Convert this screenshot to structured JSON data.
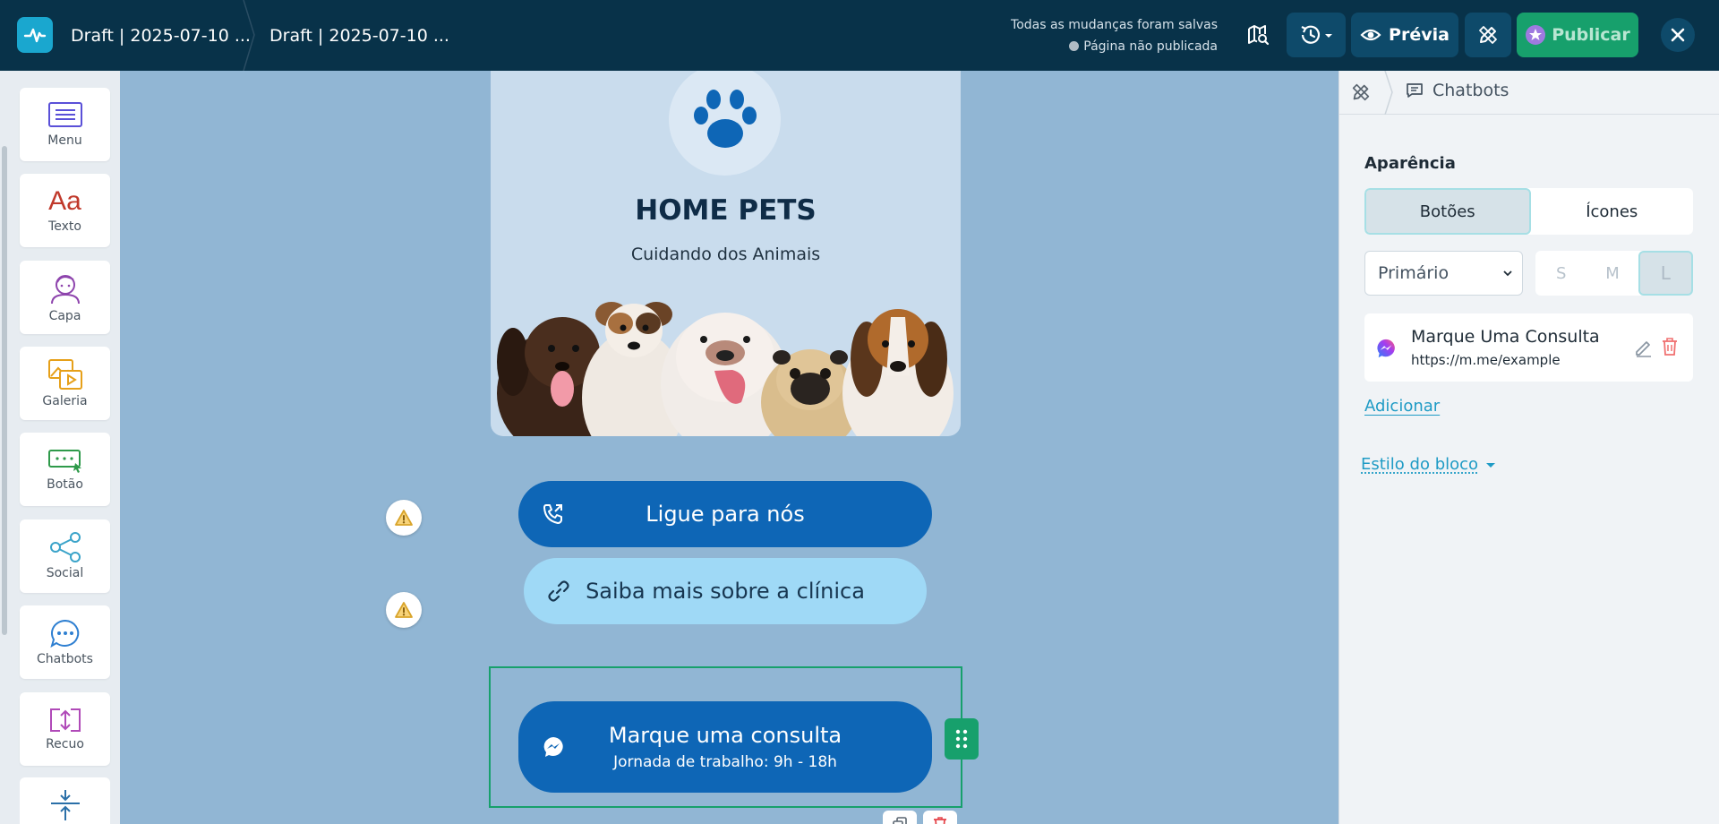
{
  "topbar": {
    "breadcrumb_1": "Draft | 2025-07-10 ...",
    "breadcrumb_2": "Draft | 2025-07-10 ...",
    "save_status": "Todas as mudanças foram salvas",
    "publish_status": "Página não publicada",
    "preview_label": "Prévia",
    "publish_label": "Publicar"
  },
  "rail": {
    "items": [
      {
        "label": "Menu",
        "icon": "menu-icon"
      },
      {
        "label": "Texto",
        "icon": "text-icon"
      },
      {
        "label": "Capa",
        "icon": "cover-icon"
      },
      {
        "label": "Galeria",
        "icon": "gallery-icon"
      },
      {
        "label": "Botão",
        "icon": "button-icon"
      },
      {
        "label": "Social",
        "icon": "share-icon"
      },
      {
        "label": "Chatbots",
        "icon": "chat-icon"
      },
      {
        "label": "Recuo",
        "icon": "spacing-icon"
      }
    ]
  },
  "canvas": {
    "brand_title": "HOME PETS",
    "brand_subtitle": "Cuidando dos Animais",
    "buttons": [
      {
        "label": "Ligue para nós",
        "icon": "phone-icon"
      },
      {
        "label": "Saiba mais sobre a clínica",
        "icon": "link-icon"
      },
      {
        "label": "Marque uma consulta",
        "sublabel": "Jornada de trabalho: 9h - 18h",
        "icon": "messenger-icon"
      }
    ]
  },
  "panel": {
    "breadcrumb": "Chatbots",
    "section_title": "Aparência",
    "seg_buttons": "Botões",
    "seg_icons": "Ícones",
    "style_select": "Primário",
    "sizes": [
      "S",
      "M",
      "L"
    ],
    "selected_size": "L",
    "item": {
      "title": "Marque Uma Consulta",
      "url": "https://m.me/example"
    },
    "add_label": "Adicionar",
    "block_style_label": "Estilo do bloco"
  },
  "colors": {
    "topbar": "#083249",
    "canvas_bg": "#91b6d4",
    "primary_button": "#0e66b6",
    "light_button": "#9fd9f6",
    "accent_green": "#17a06c",
    "link": "#1f9bc5"
  }
}
